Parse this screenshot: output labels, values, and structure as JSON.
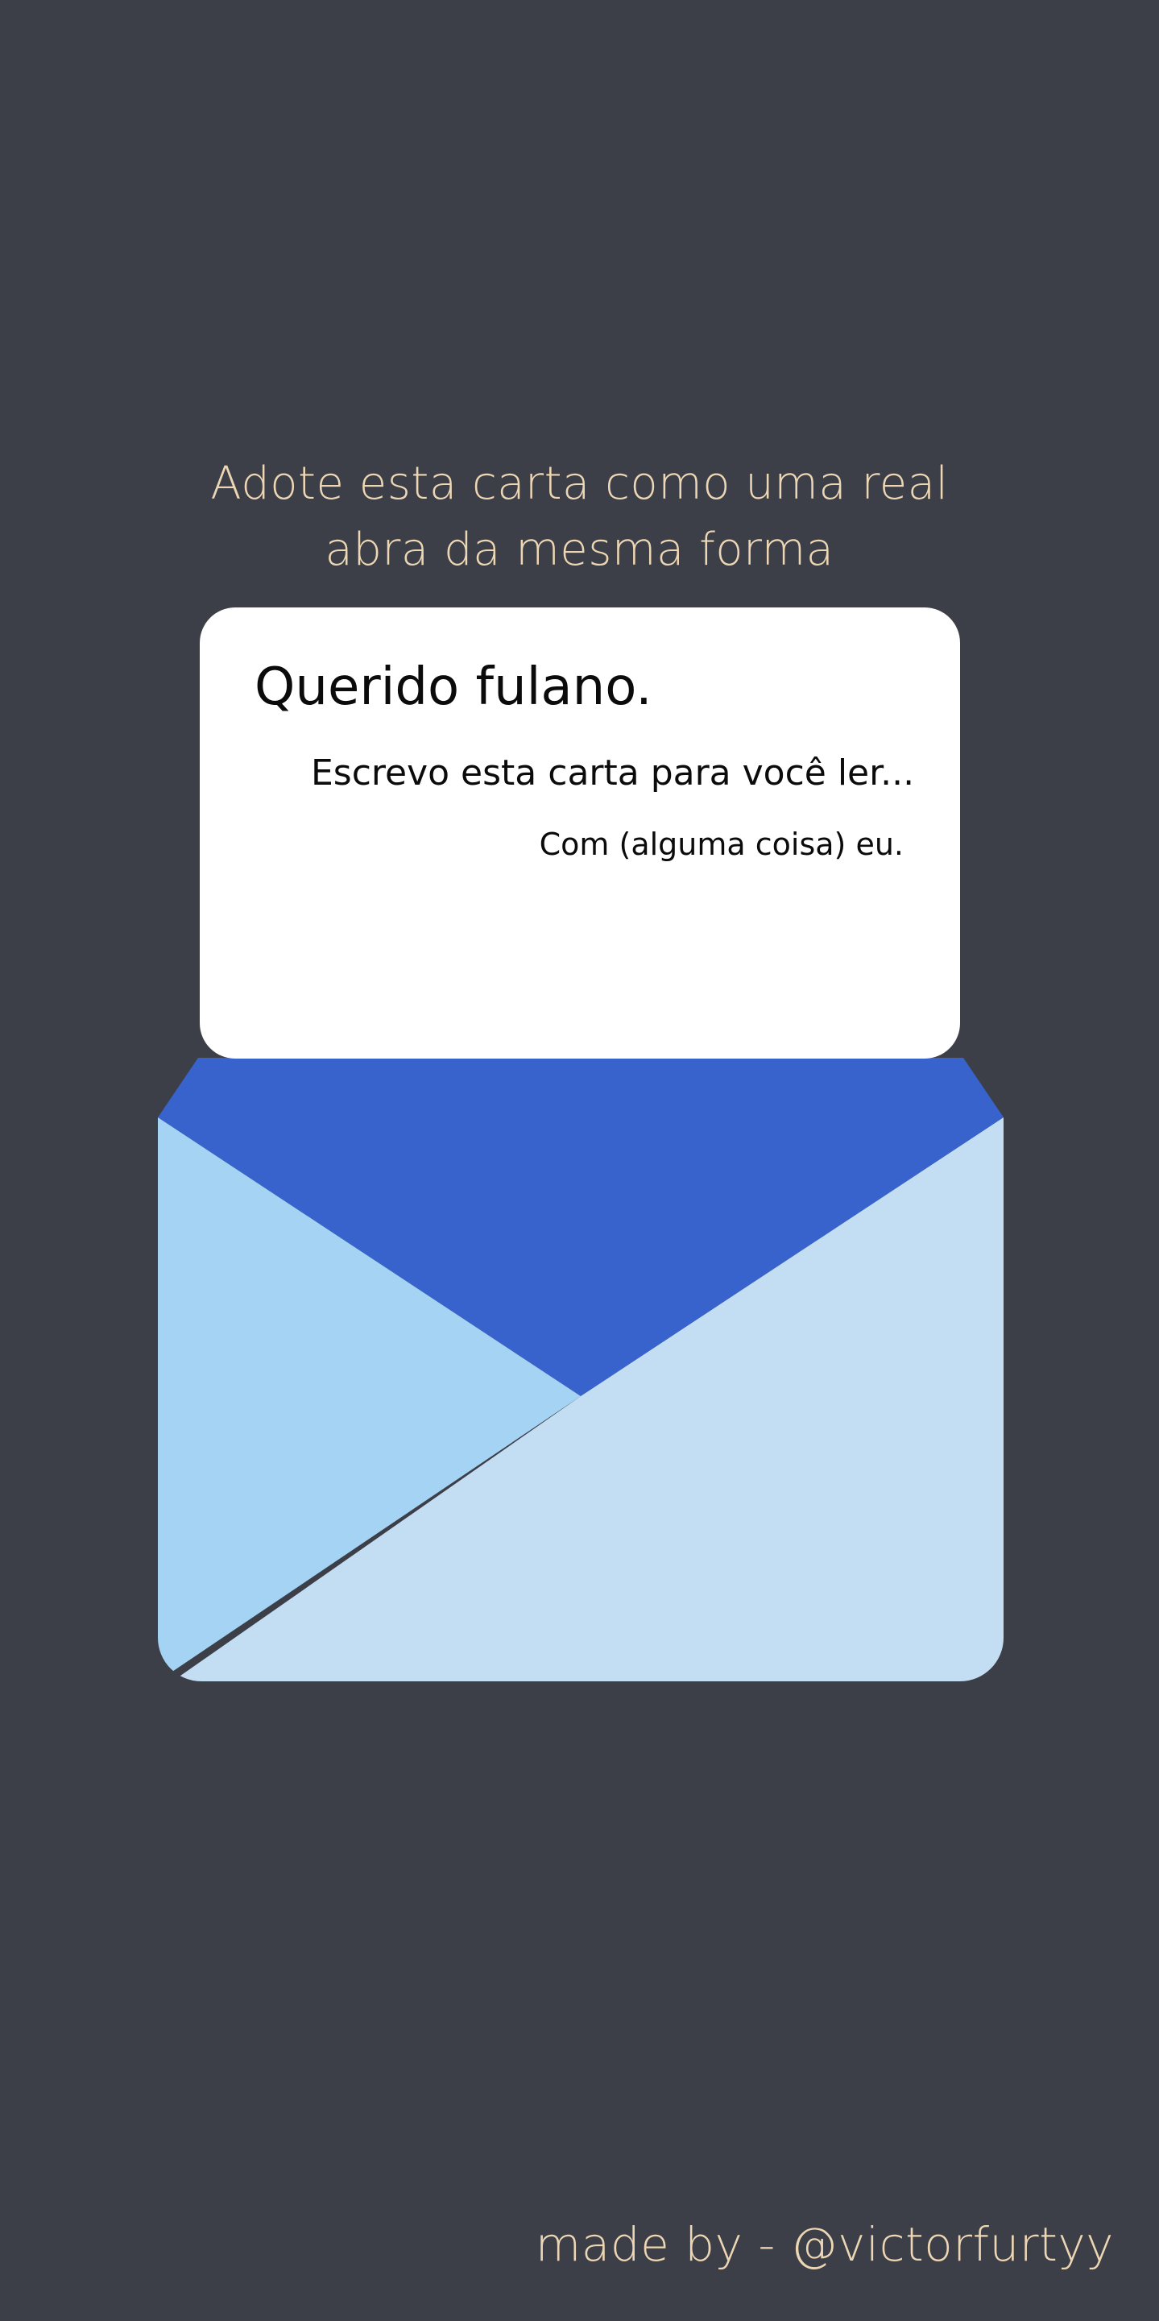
{
  "headline": {
    "line1": "Adote esta carta como uma real",
    "line2": "abra da mesma forma"
  },
  "letter": {
    "greeting": "Querido fulano.",
    "body": "Escrevo esta carta para você ler...",
    "signoff": "Com (alguma coisa) eu."
  },
  "footer": {
    "credit": "made by - @victorfurtyy"
  },
  "colors": {
    "background": "#3c3f48",
    "accent_text": "#ecd6b3",
    "envelope_flap": "#3862cc",
    "envelope_left": "#a5d3f3",
    "envelope_front": "#c3def2",
    "letter": "#ffffff"
  }
}
